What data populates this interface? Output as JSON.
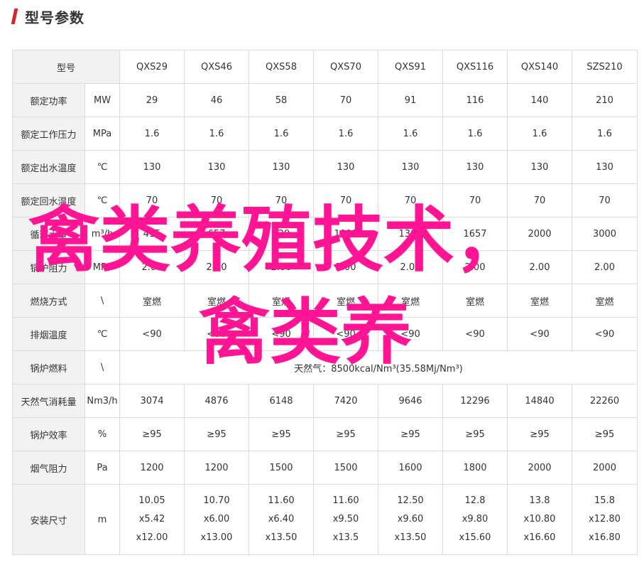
{
  "header": {
    "title": "型号参数"
  },
  "table": {
    "model_label": "型号",
    "models": [
      "QXS29",
      "QXS46",
      "QXS58",
      "QXS70",
      "QXS91",
      "QXS116",
      "QXS140",
      "SZS210"
    ],
    "rows": [
      {
        "name": "额定功率",
        "unit": "MW",
        "values": [
          "29",
          "46",
          "58",
          "70",
          "91",
          "116",
          "140",
          "210"
        ]
      },
      {
        "name": "额定工作压力",
        "unit": "MPa",
        "values": [
          "1.6",
          "1.6",
          "1.6",
          "1.6",
          "1.6",
          "1.6",
          "1.6",
          "1.6"
        ]
      },
      {
        "name": "额定出水温度",
        "unit": "℃",
        "values": [
          "130",
          "130",
          "130",
          "130",
          "130",
          "130",
          "130",
          "130"
        ]
      },
      {
        "name": "额定回水温度",
        "unit": "℃",
        "values": [
          "70",
          "70",
          "70",
          "70",
          "70",
          "70",
          "70",
          "70"
        ]
      },
      {
        "name": "循环水量",
        "unit": "m³/h",
        "values": [
          "415",
          "657",
          "829",
          "1000",
          "1300",
          "1657",
          "2000",
          "3000"
        ]
      },
      {
        "name": "锅炉阻力",
        "unit": "MPa",
        "values": [
          "2.00",
          "2.00",
          "2.00",
          "2.00",
          "2.00",
          "2.00",
          "2.00",
          "2.00"
        ]
      },
      {
        "name": "燃烧方式",
        "unit": "\\",
        "values": [
          "室燃",
          "室燃",
          "室燃",
          "室燃",
          "室燃",
          "室燃",
          "室燃",
          "室燃"
        ]
      },
      {
        "name": "排烟温度",
        "unit": "℃",
        "values": [
          "<90",
          "<90",
          "<90",
          "<90",
          "<90",
          "<90",
          "<90",
          "<90"
        ]
      },
      {
        "name": "锅炉燃料",
        "unit": "\\",
        "merged": "天然气：8500kcal/Nm³(35.58Mj/Nm³)"
      },
      {
        "name": "天然气消耗量",
        "unit": "Nm3/h",
        "values": [
          "3074",
          "4876",
          "6148",
          "7420",
          "9646",
          "12296",
          "14840",
          "22260"
        ]
      },
      {
        "name": "锅炉效率",
        "unit": "%",
        "values": [
          "≥95",
          "≥95",
          "≥95",
          "≥95",
          "≥95",
          "≥95",
          "≥95",
          "≥95"
        ]
      },
      {
        "name": "烟气阻力",
        "unit": "Pa",
        "values": [
          "1200",
          "1200",
          "1500",
          "1500",
          "1600",
          "1800",
          "2000",
          "2000"
        ]
      }
    ],
    "size_row": {
      "name": "安装尺寸",
      "unit": "m",
      "values": [
        [
          "10.05",
          "x5.42",
          "x12.00"
        ],
        [
          "10.70",
          "x6.00",
          "x13.00"
        ],
        [
          "11.60",
          "x6.40",
          "x13.50"
        ],
        [
          "11.60",
          "x9.50",
          "x13.5"
        ],
        [
          "12.50",
          "x9.60",
          "x13.50"
        ],
        [
          "12.8",
          "x9.80",
          "x15.60"
        ],
        [
          "13.8",
          "x10.80",
          "x16.60"
        ],
        [
          "15.8",
          "x12.80",
          "x16.80"
        ]
      ]
    }
  },
  "overlay": {
    "line1": "禽类养殖技术，",
    "line2": "禽类养",
    "color": "#ff1493"
  }
}
